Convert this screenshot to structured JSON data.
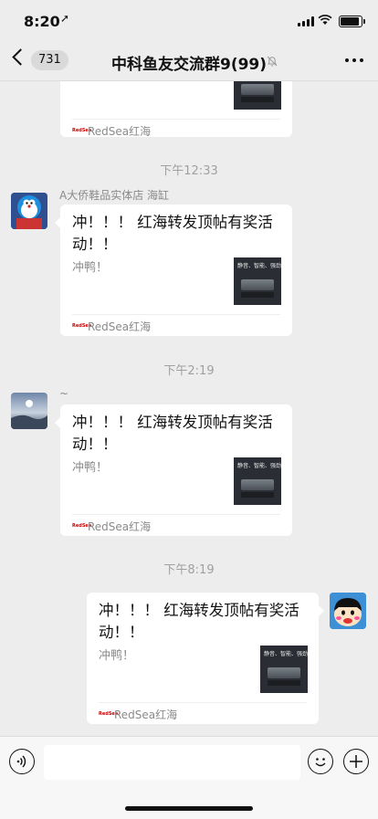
{
  "status_bar": {
    "time": "8:20",
    "location_icon": "location-arrow-icon"
  },
  "nav": {
    "unread_count": "731",
    "title": "中科鱼友交流群9(99)",
    "mute_icon": "bell-muted-icon",
    "more_icon": "more-dots-icon"
  },
  "messages": [
    {
      "sender": "",
      "title": "",
      "desc": "",
      "thumb_text": "",
      "source": "RedSea红海"
    },
    {
      "timestamp": "下午12:33",
      "sender": "A大侨鞋品实体店 海缸",
      "title": "冲！！！ 红海转发顶帖有奖活动！！",
      "desc": "冲鸭！",
      "thumb_text": "静音、智能、强劲",
      "source": "RedSea红海"
    },
    {
      "timestamp": "下午2:19",
      "sender": "~",
      "title": "冲！！！ 红海转发顶帖有奖活动！！",
      "desc": "冲鸭！",
      "thumb_text": "静音、智能、强劲",
      "source": "RedSea红海"
    },
    {
      "timestamp": "下午8:19",
      "sender": "",
      "title": "冲！！！ 红海转发顶帖有奖活动！！",
      "desc": "冲鸭！",
      "thumb_text": "静音、智能、强劲",
      "source": "RedSea红海"
    }
  ],
  "input": {
    "placeholder": ""
  },
  "colors": {
    "background": "#ededed",
    "card": "#ffffff",
    "timestamp": "#a0a0a0"
  }
}
